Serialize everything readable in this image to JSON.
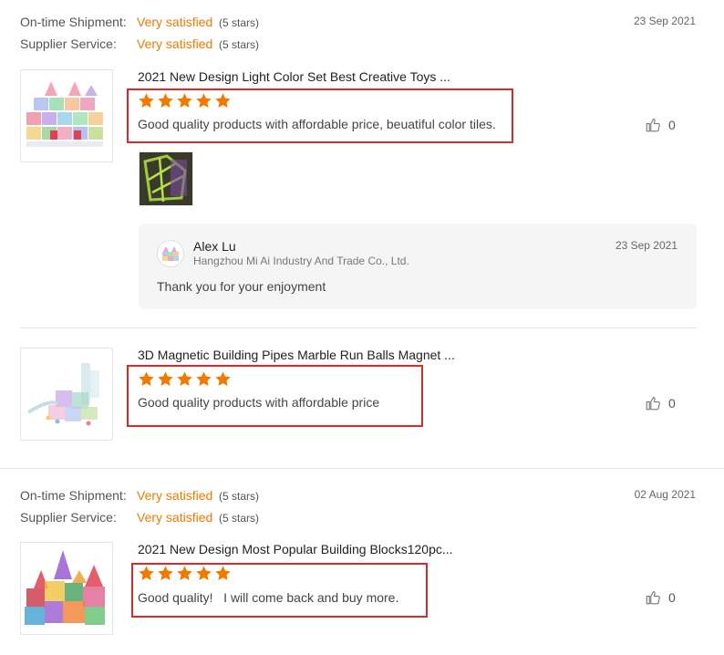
{
  "colors": {
    "accent": "#f07a00",
    "highlight_box": "#d82a2a",
    "star": "#f07a00"
  },
  "reviews": [
    {
      "shipment_label": "On-time Shipment:",
      "shipment_value": "Very satisfied",
      "shipment_stars": "(5 stars)",
      "service_label": "Supplier Service:",
      "service_value": "Very satisfied",
      "service_stars": "(5 stars)",
      "date": "23 Sep 2021",
      "items": [
        {
          "title": "2021 New Design Light Color Set Best Creative Toys ...",
          "rating": 5,
          "text": "Good quality products with affordable price, beuatiful color tiles.",
          "likes": "0",
          "reply": {
            "name": "Alex Lu",
            "company": "Hangzhou Mi Ai Industry And Trade Co., Ltd.",
            "date": "23 Sep 2021",
            "message": "Thank you for your enjoyment"
          }
        },
        {
          "title": "3D Magnetic Building Pipes Marble Run Balls Magnet ...",
          "rating": 5,
          "text": "Good quality products with affordable price",
          "likes": "0"
        }
      ]
    },
    {
      "shipment_label": "On-time Shipment:",
      "shipment_value": "Very satisfied",
      "shipment_stars": "(5 stars)",
      "service_label": "Supplier Service:",
      "service_value": "Very satisfied",
      "service_stars": "(5 stars)",
      "date": "02 Aug 2021",
      "items": [
        {
          "title": "2021 New Design Most Popular Building Blocks120pc...",
          "rating": 5,
          "text": "Good quality!   I will come back and buy more.",
          "likes": "0"
        }
      ]
    }
  ]
}
